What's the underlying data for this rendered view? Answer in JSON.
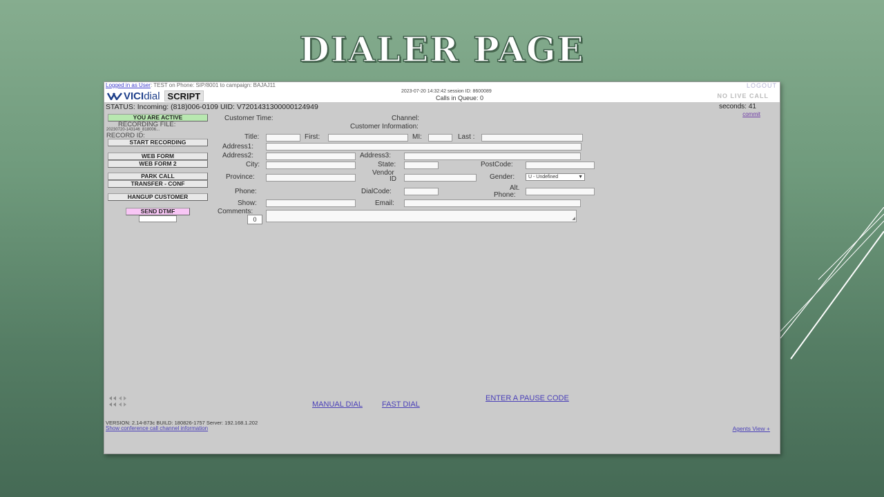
{
  "slide": {
    "title": "DIALER PAGE"
  },
  "header": {
    "logged_in_prefix": "Logged in as User",
    "logged_in_rest": ": TEST on Phone: SIP/8001  to campaign: BAJAJ11",
    "brand_vici": "VICI",
    "brand_dial": "dial",
    "script_tab": "SCRIPT",
    "datetime": "2023-07-20 14:32:42   session ID: 8600089",
    "queue": "Calls in Queue: 0",
    "logout": "LOGOUT",
    "no_live_call": "NO LIVE CALL"
  },
  "status": {
    "line": "STATUS: Incoming: (818)006-0109 UID: V7201431300000124949",
    "seconds": "seconds: 41",
    "commit": "commit"
  },
  "left_panel": {
    "active": "YOU ARE ACTIVE",
    "recording_file_label": "RECORDING FILE:",
    "recording_file_value": "20230720-143146_818006...",
    "record_id_label": "RECORD ID:",
    "start_recording": "START RECORDING",
    "web_form": "WEB FORM",
    "web_form_2": "WEB FORM 2",
    "park_call": "PARK CALL",
    "transfer_conf": "TRANSFER - CONF",
    "hangup": "HANGUP CUSTOMER",
    "send_dtmf": "SEND DTMF"
  },
  "form": {
    "customer_time": "Customer Time:",
    "channel": "Channel:",
    "customer_information": "Customer Information:",
    "title": "Title:",
    "first": "First:",
    "mi": "MI:",
    "last": "Last :",
    "address1": "Address1:",
    "address2": "Address2:",
    "address3": "Address3:",
    "city": "City:",
    "state": "State:",
    "postcode": "PostCode:",
    "province": "Province:",
    "vendor": "Vendor",
    "vendor_id": "ID",
    "gender": "Gender:",
    "gender_value": "U - Undefined",
    "phone": "Phone:",
    "dialcode": "DialCode:",
    "alt": "Alt.",
    "alt_phone": "Phone:",
    "show": "Show:",
    "email": "Email:",
    "comments": "Comments:",
    "comments_count": "0"
  },
  "links": {
    "pause_code": "ENTER A PAUSE CODE",
    "manual_dial": "MANUAL DIAL",
    "fast_dial": "FAST DIAL",
    "agents_view": "Agents View +"
  },
  "footer": {
    "version": "VERSION: 2.14-873c   BUILD: 180826-1757    Server: 192.168.1.202",
    "conference": "Show conference call channel information"
  }
}
